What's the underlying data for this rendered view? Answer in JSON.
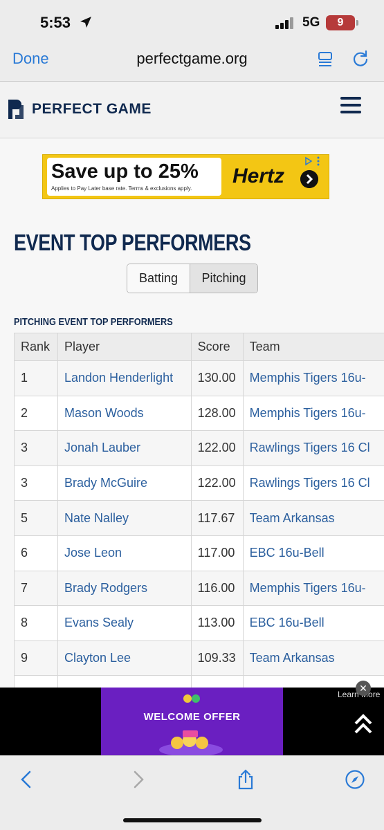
{
  "status_bar": {
    "time": "5:53",
    "network": "5G",
    "battery": "9"
  },
  "browser": {
    "done_label": "Done",
    "url": "perfectgame.org"
  },
  "site": {
    "logo_text": "PERFECT GAME"
  },
  "ad_banner": {
    "headline": "Save up to 25%",
    "fine_print": "Applies to Pay Later base rate. Terms & exclusions apply.",
    "brand": "Hertz",
    "colors": {
      "background": "#f3c614"
    }
  },
  "page": {
    "title": "EVENT TOP PERFORMERS",
    "tabs": [
      {
        "label": "Batting",
        "active": false
      },
      {
        "label": "Pitching",
        "active": true
      }
    ],
    "table_title": "PITCHING EVENT TOP PERFORMERS"
  },
  "table": {
    "headers": [
      "Rank",
      "Player",
      "Score",
      "Team"
    ],
    "rows": [
      {
        "rank": "1",
        "player": "Landon Henderlight",
        "score": "130.00",
        "team": "Memphis Tigers 16u-"
      },
      {
        "rank": "2",
        "player": "Mason Woods",
        "score": "128.00",
        "team": "Memphis Tigers 16u-"
      },
      {
        "rank": "3",
        "player": "Jonah Lauber",
        "score": "122.00",
        "team": "Rawlings Tigers 16 Cl"
      },
      {
        "rank": "3",
        "player": "Brady McGuire",
        "score": "122.00",
        "team": "Rawlings Tigers 16 Cl"
      },
      {
        "rank": "5",
        "player": "Nate Nalley",
        "score": "117.67",
        "team": "Team Arkansas"
      },
      {
        "rank": "6",
        "player": "Jose Leon",
        "score": "117.00",
        "team": "EBC 16u-Bell"
      },
      {
        "rank": "7",
        "player": "Brady Rodgers",
        "score": "116.00",
        "team": "Memphis Tigers 16u-"
      },
      {
        "rank": "8",
        "player": "Evans Sealy",
        "score": "113.00",
        "team": "EBC 16u-Bell"
      },
      {
        "rank": "9",
        "player": "Clayton Lee",
        "score": "109.33",
        "team": "Team Arkansas"
      }
    ]
  },
  "bottom_ad": {
    "promo_title": "WELCOME OFFER",
    "learn_more": "Learn More",
    "close": "✕"
  },
  "toolbar": {
    "icons": [
      "back-icon",
      "forward-icon",
      "share-icon",
      "compass-icon"
    ]
  },
  "colors": {
    "accent": "#2a7ad6",
    "brand_navy": "#10294f",
    "link": "#2b5f9e"
  }
}
